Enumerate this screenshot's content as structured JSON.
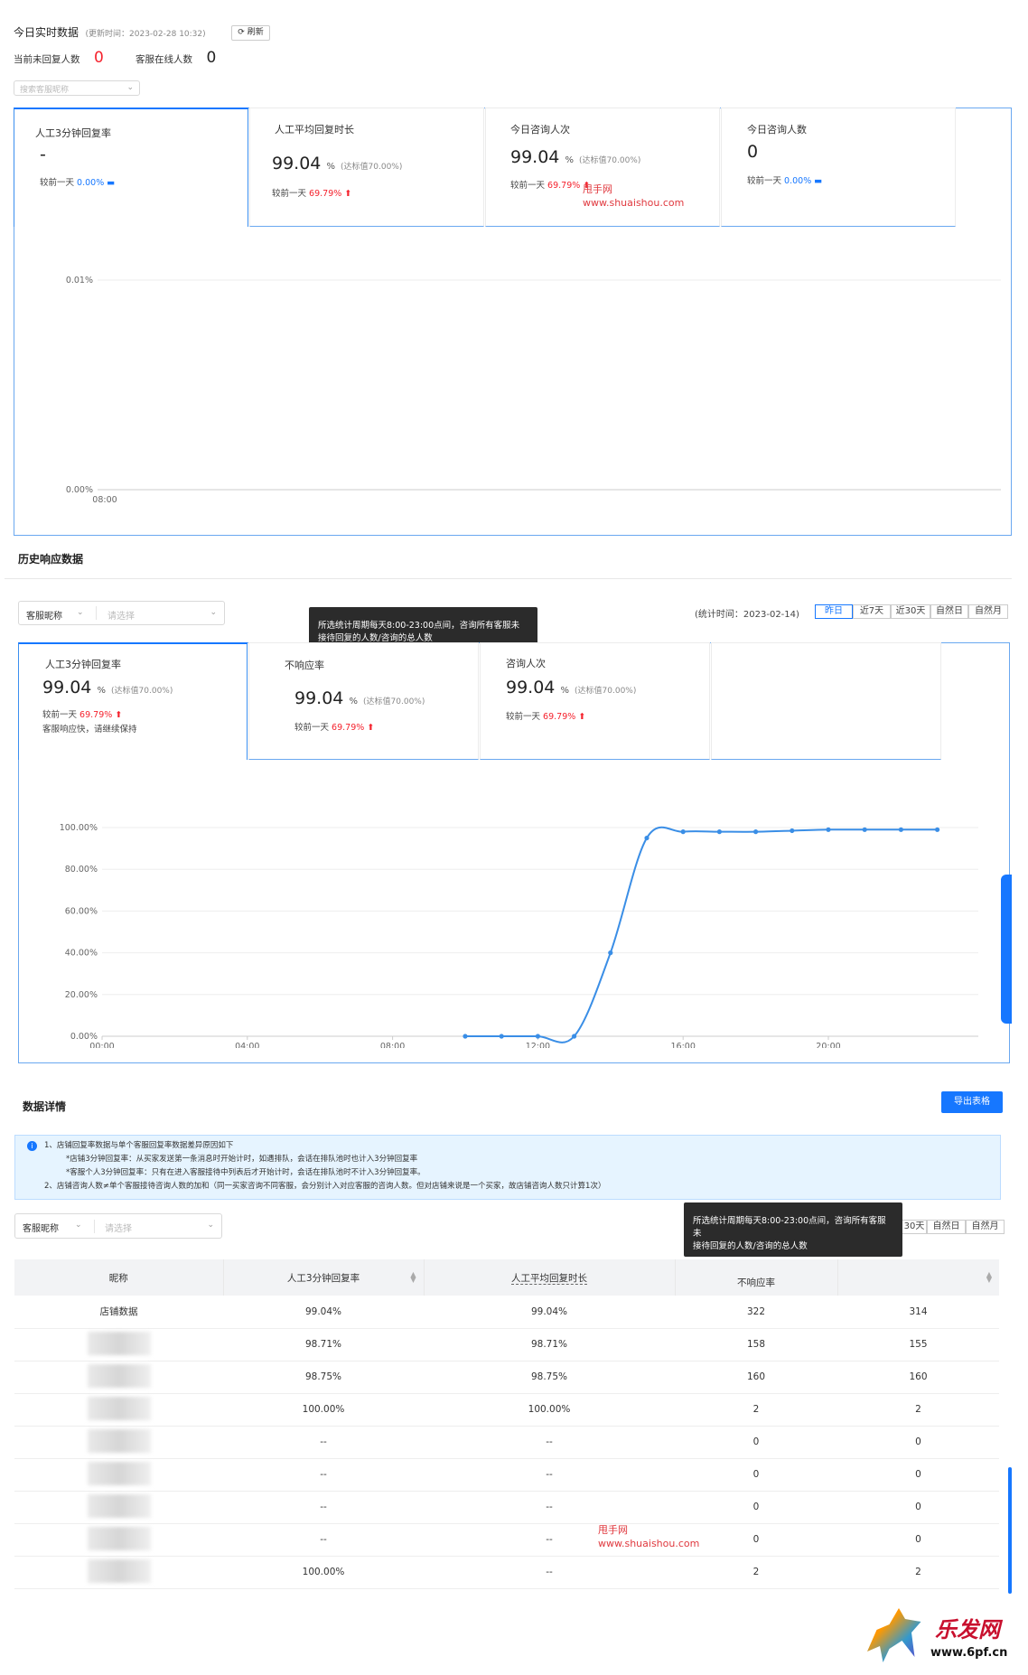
{
  "realtime": {
    "title": "今日实时数据",
    "update_time": "(更新时间：2023-02-28 10:32)",
    "refresh_label": "刷新",
    "unreplied_label": "当前未回复人数",
    "unreplied_value": "0",
    "online_label": "客服在线人数",
    "online_value": "0",
    "search_placeholder": "搜索客服昵称"
  },
  "realtime_cards": [
    {
      "title": "人工3分钟回复率",
      "value": "-",
      "unit": "",
      "target": "",
      "compare_label": "较前一天",
      "compare_value": "0.00%"
    },
    {
      "title": "人工平均回复时长",
      "value": "99.04",
      "unit": "%",
      "target": "(达标值70.00%)",
      "compare_label": "较前一天",
      "compare_value": "69.79%"
    },
    {
      "title": "今日咨询人次",
      "value": "99.04",
      "unit": "%",
      "target": "(达标值70.00%)",
      "compare_label": "较前一天",
      "compare_value": "69.79%"
    },
    {
      "title": "今日咨询人数",
      "value": "0",
      "unit": "",
      "target": "",
      "compare_label": "较前一天",
      "compare_value": "0.00%"
    }
  ],
  "watermark": {
    "line1": "甩手网",
    "line2": "www.shuaishou.com"
  },
  "chart_data": [
    {
      "type": "line",
      "x": [
        "08:00"
      ],
      "ytick_labels": [
        "0.00%",
        "0.01%"
      ],
      "ylim": [
        0,
        0.01
      ],
      "series": [
        {
          "values": []
        }
      ],
      "grid": true
    },
    {
      "type": "line",
      "xtick_labels": [
        "00:00",
        "04:00",
        "08:00",
        "12:00",
        "16:00",
        "20:00"
      ],
      "ytick_labels": [
        "0.00%",
        "20.00%",
        "40.00%",
        "60.00%",
        "80.00%",
        "100.00%"
      ],
      "ylim": [
        0,
        100
      ],
      "x_hours": [
        10,
        11,
        12,
        13,
        14,
        15,
        16,
        17,
        18,
        19,
        20,
        21,
        22,
        23
      ],
      "series": [
        {
          "values": [
            0,
            0,
            0,
            0,
            40,
            95,
            98,
            98,
            98,
            98.5,
            99,
            99,
            99,
            99
          ]
        }
      ],
      "grid": true,
      "color": "#3a8ee6"
    }
  ],
  "history": {
    "title": "历史响应数据",
    "filter_label": "客服昵称",
    "filter_placeholder": "请选择",
    "stat_time": "(统计时间：2023-02-14)",
    "ranges": [
      "昨日",
      "近7天",
      "近30天",
      "自然日",
      "自然月"
    ],
    "tooltip_line1": "所选统计周期每天8:00-23:00点间，咨询所有客服未",
    "tooltip_line2": "接待回复的人数/咨询的总人数"
  },
  "history_cards": [
    {
      "title": "人工3分钟回复率",
      "value": "99.04",
      "unit": "%",
      "target": "(达标值70.00%)",
      "compare_label": "较前一天",
      "compare_value": "69.79%",
      "note": "客服响应快，请继续保持"
    },
    {
      "title": "不响应率",
      "value": "99.04",
      "unit": "%",
      "target": "(达标值70.00%)",
      "compare_label": "较前一天",
      "compare_value": "69.79%",
      "note": ""
    },
    {
      "title": "咨询人次",
      "value": "99.04",
      "unit": "%",
      "target": "(达标值70.00%)",
      "compare_label": "较前一天",
      "compare_value": "69.79%",
      "note": ""
    }
  ],
  "details": {
    "title": "数据详情",
    "export_label": "导出表格",
    "notice": [
      "1、店铺回复率数据与单个客服回复率数据差异原因如下",
      "*店铺3分钟回复率：从买家发送第一条消息时开始计时，如遇排队，会话在排队池时也计入3分钟回复率",
      "*客服个人3分钟回复率：只有在进入客服接待中列表后才开始计时，会话在排队池时不计入3分钟回复率。",
      "2、店铺咨询人数≠单个客服接待咨询人数的加和（同一买家咨询不同客服，会分别计入对应客服的咨询人数。但对店铺来说是一个买家，故店铺咨询人数只计算1次）"
    ],
    "filter_label": "客服昵称",
    "filter_placeholder": "请选择",
    "ranges_visible": [
      "30天",
      "自然日",
      "自然月"
    ],
    "tooltip_line1": "所选统计周期每天8:00-23:00点间，咨询所有客服未",
    "tooltip_line2": "接待回复的人数/咨询的总人数",
    "columns": [
      "昵称",
      "人工3分钟回复率",
      "人工平均回复时长",
      "不响应率",
      ""
    ],
    "rows": [
      [
        "店铺数据",
        "99.04%",
        "99.04%",
        "322",
        "314"
      ],
      [
        "",
        "98.71%",
        "98.71%",
        "158",
        "155"
      ],
      [
        "",
        "98.75%",
        "98.75%",
        "160",
        "160"
      ],
      [
        "",
        "100.00%",
        "100.00%",
        "2",
        "2"
      ],
      [
        "",
        "--",
        "--",
        "0",
        "0"
      ],
      [
        "",
        "--",
        "--",
        "0",
        "0"
      ],
      [
        "",
        "--",
        "--",
        "0",
        "0"
      ],
      [
        "",
        "--",
        "--",
        "0",
        "0"
      ],
      [
        "",
        "100.00%",
        "--",
        "2",
        "2"
      ]
    ]
  },
  "corner_logo": {
    "text": "乐发网",
    "url_text": "www.6pf.cn"
  }
}
